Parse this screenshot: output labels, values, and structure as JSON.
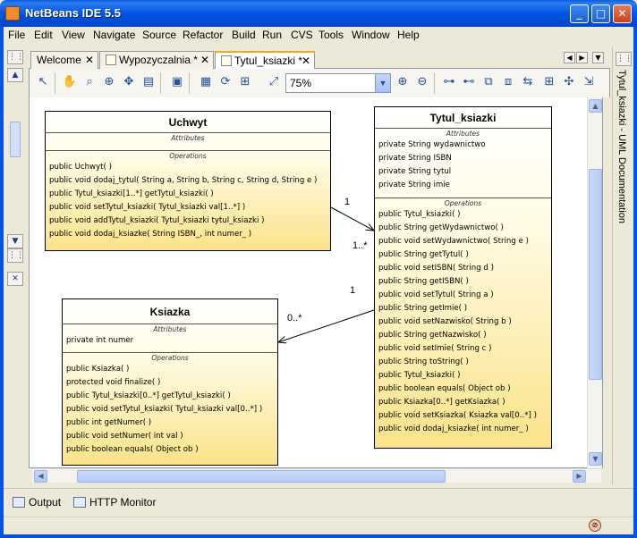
{
  "window": {
    "title": "NetBeans IDE 5.5"
  },
  "menu": [
    "File",
    "Edit",
    "View",
    "Navigate",
    "Source",
    "Refactor",
    "Build",
    "Run",
    "CVS",
    "Tools",
    "Window",
    "Help"
  ],
  "tabs": [
    {
      "label": "Welcome",
      "active": false
    },
    {
      "label": "Wypozyczalnia *",
      "active": false
    },
    {
      "label": "Tytul_ksiazki *",
      "active": true
    }
  ],
  "toolbar": {
    "zoom": "75%"
  },
  "side_panel": {
    "label": "Tytul_ksiazki - UML Documentation"
  },
  "diagram": {
    "classes": {
      "uchwyt": {
        "name": "Uchwyt",
        "attributes_title": "Attributes",
        "attributes": [],
        "operations_title": "Operations",
        "operations": [
          "public Uchwyt( )",
          "public void  dodaj_tytul( String a, String b, String c, String d, String e )",
          "public Tytul_ksiazki[1..*]  getTytul_ksiazki( )",
          "public void  setTytul_ksiazki( Tytul_ksiazki val[1..*] )",
          "public void  addTytul_ksiazki( Tytul_ksiazki tytul_ksiazki )",
          "public void  dodaj_ksiazke( String ISBN_, int numer_ )"
        ]
      },
      "tytul_ksiazki": {
        "name": "Tytul_ksiazki",
        "attributes_title": "Attributes",
        "attributes": [
          "private String wydawnictwo",
          "private String ISBN",
          "private String tytul",
          "private String imie"
        ],
        "operations_title": "Operations",
        "operations": [
          "public Tytul_ksiazki( )",
          "public String  getWydawnictwo( )",
          "public void  setWydawnictwo( String e )",
          "public String  getTytul( )",
          "public void  setISBN( String d )",
          "public String  getISBN( )",
          "public void  setTytul( String a )",
          "public String  getImie( )",
          "public void  setNazwisko( String b )",
          "public String  getNazwisko( )",
          "public void  setImie( String c )",
          "public String  toString( )",
          "public Tytul_ksiazki( )",
          "public boolean  equals( Object ob )",
          "public Ksiazka[0..*]  getKsiazka( )",
          "public void  setKsiazka( Ksiazka val[0..*] )",
          "public void  dodaj_ksiazke( int numer_ )"
        ]
      },
      "ksiazka": {
        "name": "Ksiazka",
        "attributes_title": "Attributes",
        "attributes": [
          "private int numer"
        ],
        "operations_title": "Operations",
        "operations": [
          "public Ksiazka( )",
          "protected void  finalize( )",
          "public Tytul_ksiazki[0..*]  getTytul_ksiazki( )",
          "public void  setTytul_ksiazki( Tytul_ksiazki val[0..*] )",
          "public int  getNumer( )",
          "public void  setNumer( int val )",
          "public boolean  equals( Object ob )"
        ]
      }
    },
    "multiplicities": {
      "uchwyt_end": "1",
      "tytul_end_a": "1..*",
      "tytul_end_b": "1",
      "ksiazka_end": "0..*"
    }
  },
  "bottom_tabs": [
    "Output",
    "HTTP Monitor"
  ]
}
